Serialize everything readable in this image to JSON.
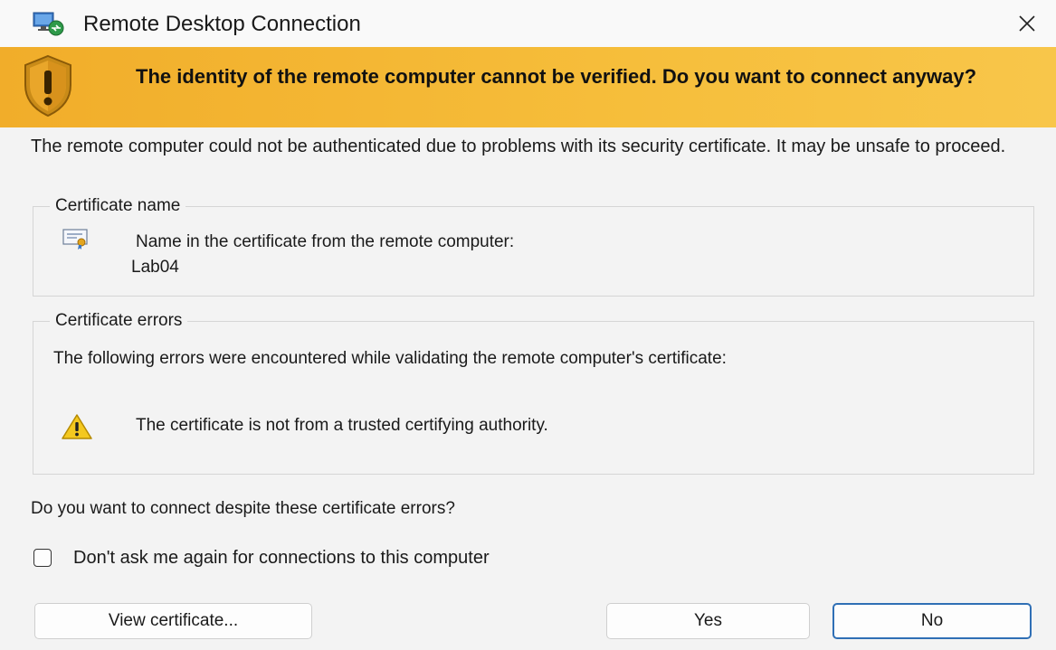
{
  "window": {
    "title": "Remote Desktop Connection",
    "close_glyph": "✕"
  },
  "banner": {
    "icon": "shield-warning-icon",
    "heading": "The identity of the remote computer cannot be verified. Do you want to connect anyway?"
  },
  "intro": "The remote computer could not be authenticated due to problems with its security certificate. It may be unsafe to proceed.",
  "certificate_name": {
    "legend": "Certificate name",
    "icon": "certificate-icon",
    "label": "Name in the certificate from the remote computer:",
    "value": "Lab04"
  },
  "certificate_errors": {
    "legend": "Certificate errors",
    "intro": "The following errors were encountered while validating the remote computer's certificate:",
    "items": [
      {
        "icon": "warning-icon",
        "text": "The certificate is not from a trusted certifying authority."
      }
    ]
  },
  "question": "Do you want to connect despite these certificate errors?",
  "dont_ask_checkbox": {
    "label": "Don't ask me again for connections to this computer",
    "checked": false
  },
  "buttons": {
    "view_certificate": "View certificate...",
    "yes": "Yes",
    "no": "No"
  },
  "colors": {
    "banner": "#f6be3b",
    "default_button_border": "#2f6fb5"
  }
}
